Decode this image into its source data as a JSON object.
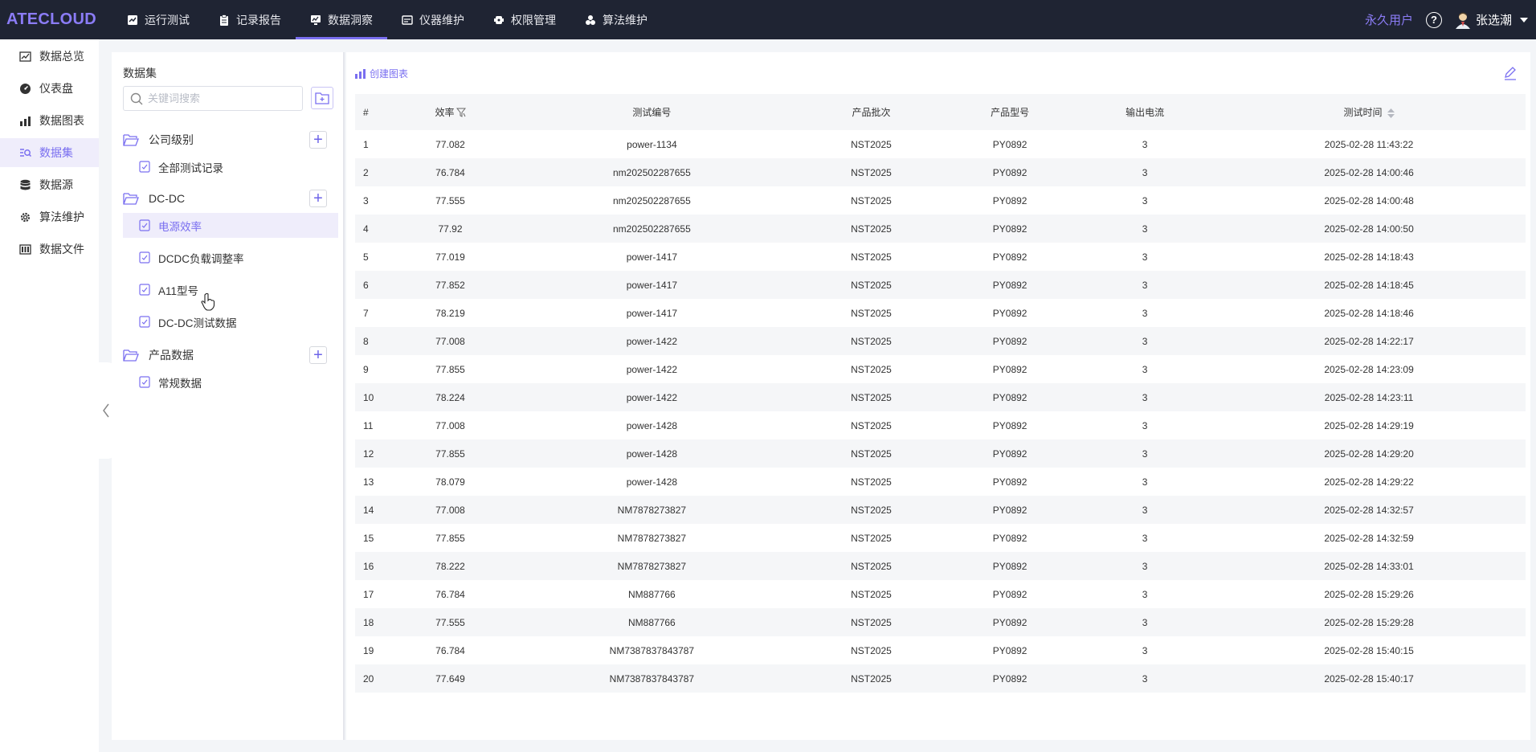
{
  "app": {
    "logo": "ATECLOUD"
  },
  "topnav": {
    "items": [
      {
        "label": "运行测试",
        "icon": "run-test-icon"
      },
      {
        "label": "记录报告",
        "icon": "clipboard-icon"
      },
      {
        "label": "数据洞察",
        "icon": "monitor-chart-icon",
        "active": true
      },
      {
        "label": "仪器维护",
        "icon": "instrument-icon"
      },
      {
        "label": "权限管理",
        "icon": "permission-icon"
      },
      {
        "label": "算法维护",
        "icon": "algorithm-icon"
      }
    ],
    "forever_user": "永久用户",
    "username": "张选潮"
  },
  "sidebar": {
    "items": [
      {
        "label": "数据总览",
        "icon": "chart-window-icon"
      },
      {
        "label": "仪表盘",
        "icon": "gauge-icon"
      },
      {
        "label": "数据图表",
        "icon": "bar-chart-icon"
      },
      {
        "label": "数据集",
        "icon": "dataset-search-icon",
        "active": true
      },
      {
        "label": "数据源",
        "icon": "database-icon"
      },
      {
        "label": "算法维护",
        "icon": "gear-icon"
      },
      {
        "label": "数据文件",
        "icon": "columns-icon"
      }
    ]
  },
  "dataset_panel": {
    "title": "数据集",
    "search_placeholder": "关键词搜索",
    "folders": [
      {
        "name": "公司级别",
        "items": [
          "全部测试记录"
        ]
      },
      {
        "name": "DC-DC",
        "items": [
          "电源效率",
          "DCDC负载调整率",
          "A11型号",
          "DC-DC测试数据"
        ]
      },
      {
        "name": "产品数据",
        "items": [
          "常规数据"
        ]
      }
    ],
    "selected": "电源效率"
  },
  "table_panel": {
    "create_chart_label": "创建图表",
    "columns": [
      "#",
      "效率",
      "测试编号",
      "产品批次",
      "产品型号",
      "输出电流",
      "测试时间"
    ],
    "rows": [
      [
        "1",
        "77.082",
        "power-1134",
        "NST2025",
        "PY0892",
        "3",
        "2025-02-28 11:43:22"
      ],
      [
        "2",
        "76.784",
        "nm202502287655",
        "NST2025",
        "PY0892",
        "3",
        "2025-02-28 14:00:46"
      ],
      [
        "3",
        "77.555",
        "nm202502287655",
        "NST2025",
        "PY0892",
        "3",
        "2025-02-28 14:00:48"
      ],
      [
        "4",
        "77.92",
        "nm202502287655",
        "NST2025",
        "PY0892",
        "3",
        "2025-02-28 14:00:50"
      ],
      [
        "5",
        "77.019",
        "power-1417",
        "NST2025",
        "PY0892",
        "3",
        "2025-02-28 14:18:43"
      ],
      [
        "6",
        "77.852",
        "power-1417",
        "NST2025",
        "PY0892",
        "3",
        "2025-02-28 14:18:45"
      ],
      [
        "7",
        "78.219",
        "power-1417",
        "NST2025",
        "PY0892",
        "3",
        "2025-02-28 14:18:46"
      ],
      [
        "8",
        "77.008",
        "power-1422",
        "NST2025",
        "PY0892",
        "3",
        "2025-02-28 14:22:17"
      ],
      [
        "9",
        "77.855",
        "power-1422",
        "NST2025",
        "PY0892",
        "3",
        "2025-02-28 14:23:09"
      ],
      [
        "10",
        "78.224",
        "power-1422",
        "NST2025",
        "PY0892",
        "3",
        "2025-02-28 14:23:11"
      ],
      [
        "11",
        "77.008",
        "power-1428",
        "NST2025",
        "PY0892",
        "3",
        "2025-02-28 14:29:19"
      ],
      [
        "12",
        "77.855",
        "power-1428",
        "NST2025",
        "PY0892",
        "3",
        "2025-02-28 14:29:20"
      ],
      [
        "13",
        "78.079",
        "power-1428",
        "NST2025",
        "PY0892",
        "3",
        "2025-02-28 14:29:22"
      ],
      [
        "14",
        "77.008",
        "NM7878273827",
        "NST2025",
        "PY0892",
        "3",
        "2025-02-28 14:32:57"
      ],
      [
        "15",
        "77.855",
        "NM7878273827",
        "NST2025",
        "PY0892",
        "3",
        "2025-02-28 14:32:59"
      ],
      [
        "16",
        "78.222",
        "NM7878273827",
        "NST2025",
        "PY0892",
        "3",
        "2025-02-28 14:33:01"
      ],
      [
        "17",
        "76.784",
        "NM887766",
        "NST2025",
        "PY0892",
        "3",
        "2025-02-28 15:29:26"
      ],
      [
        "18",
        "77.555",
        "NM887766",
        "NST2025",
        "PY0892",
        "3",
        "2025-02-28 15:29:28"
      ],
      [
        "19",
        "76.784",
        "NM7387837843787",
        "NST2025",
        "PY0892",
        "3",
        "2025-02-28 15:40:15"
      ],
      [
        "20",
        "77.649",
        "NM7387837843787",
        "NST2025",
        "PY0892",
        "3",
        "2025-02-28 15:40:17"
      ]
    ]
  },
  "colors": {
    "accent": "#7a6ff0",
    "topbar": "#1f2433",
    "logo": "#8b7cf6",
    "row_stripe": "#f5f6f8"
  }
}
